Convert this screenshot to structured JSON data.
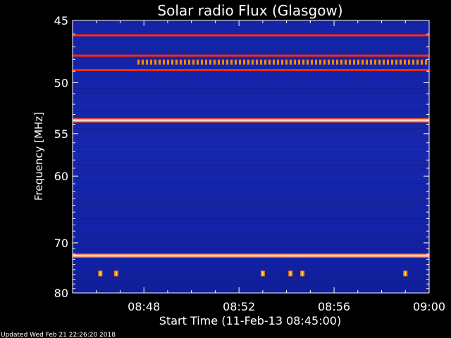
{
  "updated_text": "Updated Wed Feb 21 22:26:20 2018",
  "chart_data": {
    "type": "heatmap",
    "title": "Solar radio Flux (Glasgow)",
    "xlabel": "Start Time (11-Feb-13 08:45:00)",
    "ylabel": "Frequency [MHz]",
    "x_range": [
      "08:45:00",
      "09:00:00"
    ],
    "y_range_mhz": [
      45,
      80
    ],
    "y_tick_labels": [
      "45",
      "50",
      "55",
      "60",
      "70",
      "80"
    ],
    "y_tick_values": [
      45,
      50,
      55,
      60,
      70,
      80
    ],
    "x_tick_labels": [
      "08:48",
      "08:52",
      "08:56",
      "09:00"
    ],
    "x_tick_minutes": [
      3,
      7,
      11,
      15
    ],
    "colormap": [
      "#000060",
      "#0a1aa0",
      "#2030c8",
      "#ff2a00",
      "#ffd000",
      "#ffffe0"
    ],
    "background_color": "#1525a8",
    "emission_bands": [
      {
        "freq_mhz": 46.1,
        "intensity": "strong"
      },
      {
        "freq_mhz": 47.7,
        "intensity": "strong"
      },
      {
        "freq_mhz": 48.2,
        "intensity": "moderate",
        "intermittent": true
      },
      {
        "freq_mhz": 48.9,
        "intensity": "strong"
      },
      {
        "freq_mhz": 53.6,
        "intensity": "very strong"
      },
      {
        "freq_mhz": 72.3,
        "intensity": "very strong"
      }
    ],
    "bursts": [
      {
        "time": "08:46:10",
        "freq_mhz": 75.8
      },
      {
        "time": "08:46:50",
        "freq_mhz": 75.8
      },
      {
        "time": "08:53:00",
        "freq_mhz": 75.8
      },
      {
        "time": "08:54:10",
        "freq_mhz": 75.8
      },
      {
        "time": "08:54:40",
        "freq_mhz": 75.8
      },
      {
        "time": "08:59:00",
        "freq_mhz": 75.8
      }
    ]
  }
}
